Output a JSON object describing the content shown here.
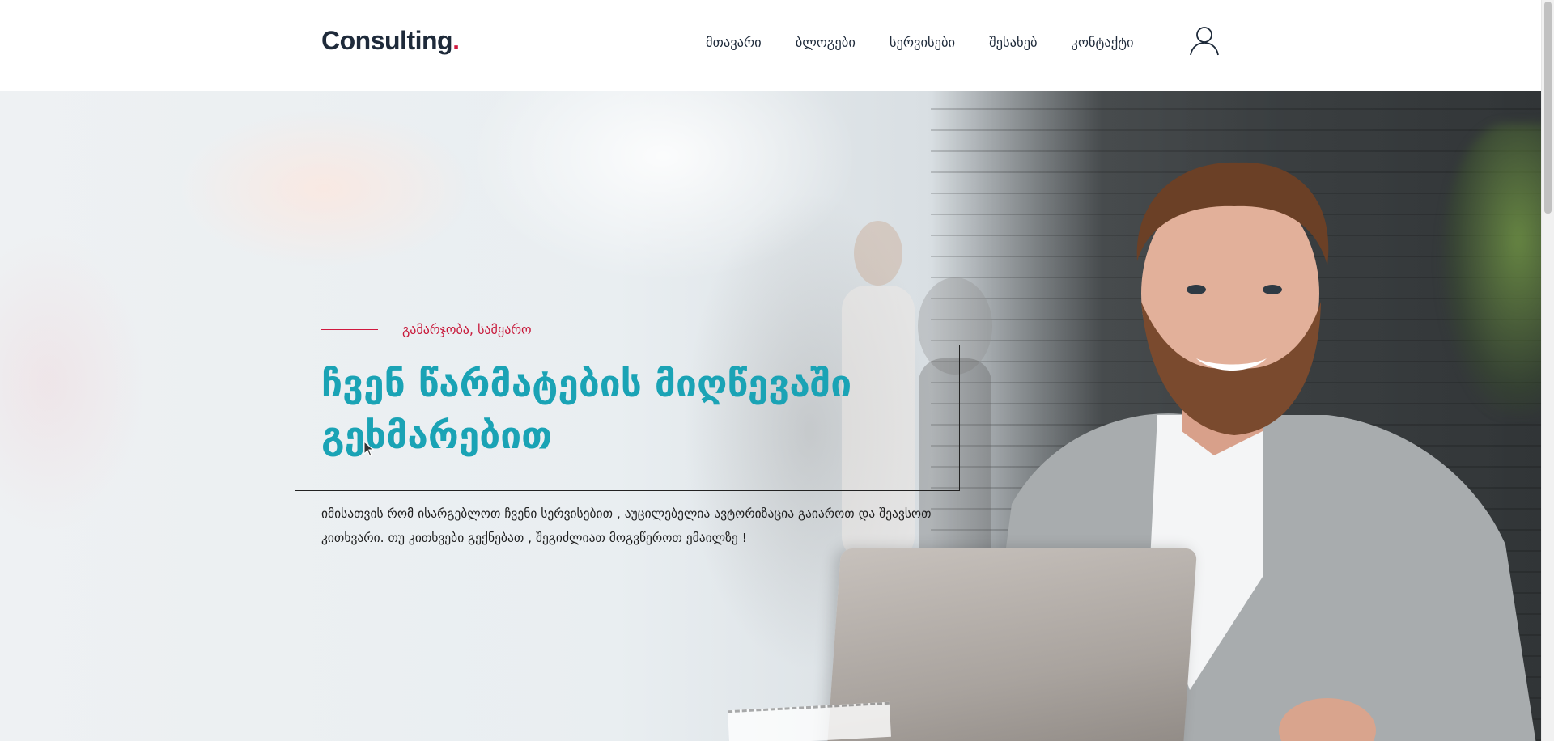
{
  "header": {
    "logo": "Consulting",
    "logo_dot": ".",
    "nav": [
      {
        "label": "მთავარი"
      },
      {
        "label": "ბლოგები"
      },
      {
        "label": "სერვისები"
      },
      {
        "label": "შესახებ"
      },
      {
        "label": "კონტაქტი"
      }
    ],
    "user_icon": "user-icon"
  },
  "hero": {
    "eyebrow": "გამარჯობა, სამყარო",
    "title": "ჩვენ წარმატების მიღწევაში გეხმარებით",
    "description": "იმისათვის რომ ისარგებლოთ ჩვენი სერვისებით , აუცილებელია ავტორიზაცია გაიაროთ და შეავსოთ კითხვარი. თუ კითხვები გექნებათ , შეგიძლიათ მოგვწეროთ ემაილზე !"
  },
  "colors": {
    "accent": "#d0193f",
    "title": "#1aa3b5",
    "text": "#1e2a3a"
  }
}
